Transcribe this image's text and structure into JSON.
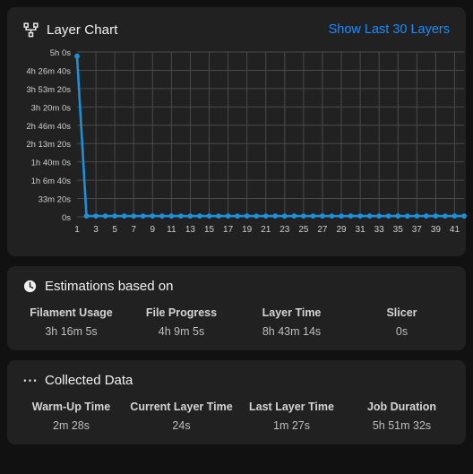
{
  "chart_panel": {
    "title": "Layer Chart",
    "title_icon": "layer-branch-icon",
    "link_label": "Show Last 30 Layers"
  },
  "estimations_panel": {
    "title": "Estimations based on",
    "title_icon": "clock-icon",
    "stats": [
      {
        "label": "Filament Usage",
        "value": "3h 16m 5s"
      },
      {
        "label": "File Progress",
        "value": "4h 9m 5s"
      },
      {
        "label": "Layer Time",
        "value": "8h 43m 14s"
      },
      {
        "label": "Slicer",
        "value": "0s"
      }
    ]
  },
  "collected_panel": {
    "title": "Collected Data",
    "title_icon": "ellipsis-icon",
    "stats": [
      {
        "label": "Warm-Up Time",
        "value": "2m 28s"
      },
      {
        "label": "Current Layer Time",
        "value": "24s"
      },
      {
        "label": "Last Layer Time",
        "value": "1m 27s"
      },
      {
        "label": "Job Duration",
        "value": "5h 51m 32s"
      }
    ]
  },
  "colors": {
    "page_background": "#111111",
    "panel_background": "#212121",
    "accent_link": "#1a8cff",
    "series_line": "#1f8fd8",
    "grid": "#4a4a4a",
    "text_primary": "#f2f2f2",
    "text_secondary": "#bfbfbf"
  },
  "chart_data": {
    "type": "line",
    "title": "Layer Chart",
    "xlabel": "",
    "ylabel": "",
    "grid": true,
    "legend": "none",
    "y_tick_labels": [
      "5h 0s",
      "4h 26m 40s",
      "3h 53m 20s",
      "3h 20m 0s",
      "2h 46m 40s",
      "2h 13m 20s",
      "1h 40m 0s",
      "1h 6m 40s",
      "33m 20s",
      "0s"
    ],
    "y_tick_values": [
      18000,
      16000,
      14000,
      12000,
      10000,
      8000,
      6000,
      4000,
      2000,
      0
    ],
    "ylim": [
      0,
      18000
    ],
    "x_tick_labels": [
      "1",
      "3",
      "5",
      "7",
      "9",
      "11",
      "13",
      "15",
      "17",
      "19",
      "21",
      "23",
      "25",
      "27",
      "29",
      "31",
      "33",
      "35",
      "37",
      "39",
      "41"
    ],
    "xlim": [
      1,
      42
    ],
    "series": [
      {
        "name": "Layer Time",
        "x": [
          1,
          2,
          3,
          4,
          5,
          6,
          7,
          8,
          9,
          10,
          11,
          12,
          13,
          14,
          15,
          16,
          17,
          18,
          19,
          20,
          21,
          22,
          23,
          24,
          25,
          26,
          27,
          28,
          29,
          30,
          31,
          32,
          33,
          34,
          35,
          36,
          37,
          38,
          39,
          40,
          41,
          42
        ],
        "values": [
          17540,
          90,
          88,
          92,
          86,
          90,
          84,
          88,
          90,
          86,
          92,
          88,
          84,
          90,
          86,
          88,
          92,
          84,
          90,
          86,
          88,
          90,
          84,
          92,
          86,
          88,
          90,
          86,
          84,
          90,
          88,
          92,
          86,
          88,
          90,
          84,
          86,
          90,
          88,
          86,
          92,
          88
        ]
      }
    ]
  }
}
